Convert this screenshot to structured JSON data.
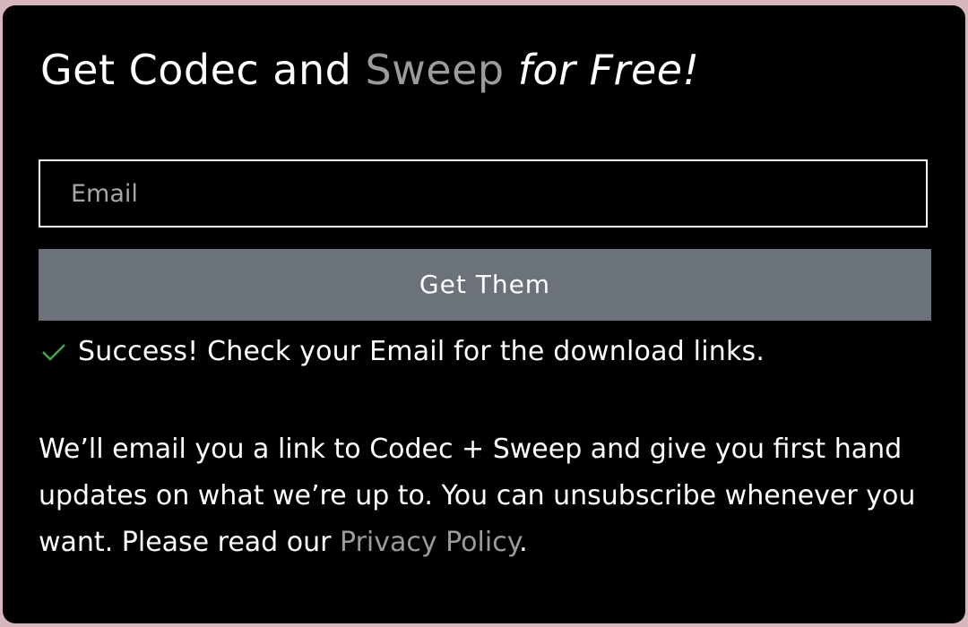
{
  "title": {
    "part1": "Get Codec and ",
    "accent": "Sweep",
    "italic": "for Free!"
  },
  "form": {
    "email_placeholder": "Email",
    "submit_label": "Get Them"
  },
  "success": {
    "icon": "check-icon",
    "message": "Success! Check your Email for the download links."
  },
  "info": {
    "text": "We’ll email you a link to Codec + Sweep and give you first hand updates on what we’re up to. You can unsubscribe whenever you want. Please read our ",
    "link_text": "Privacy Policy",
    "suffix": "."
  },
  "colors": {
    "background": "#d7b7bd",
    "panel": "#000000",
    "accent_text": "#9b9b9b",
    "button": "#6c727a",
    "success_check": "#3fa34d"
  }
}
